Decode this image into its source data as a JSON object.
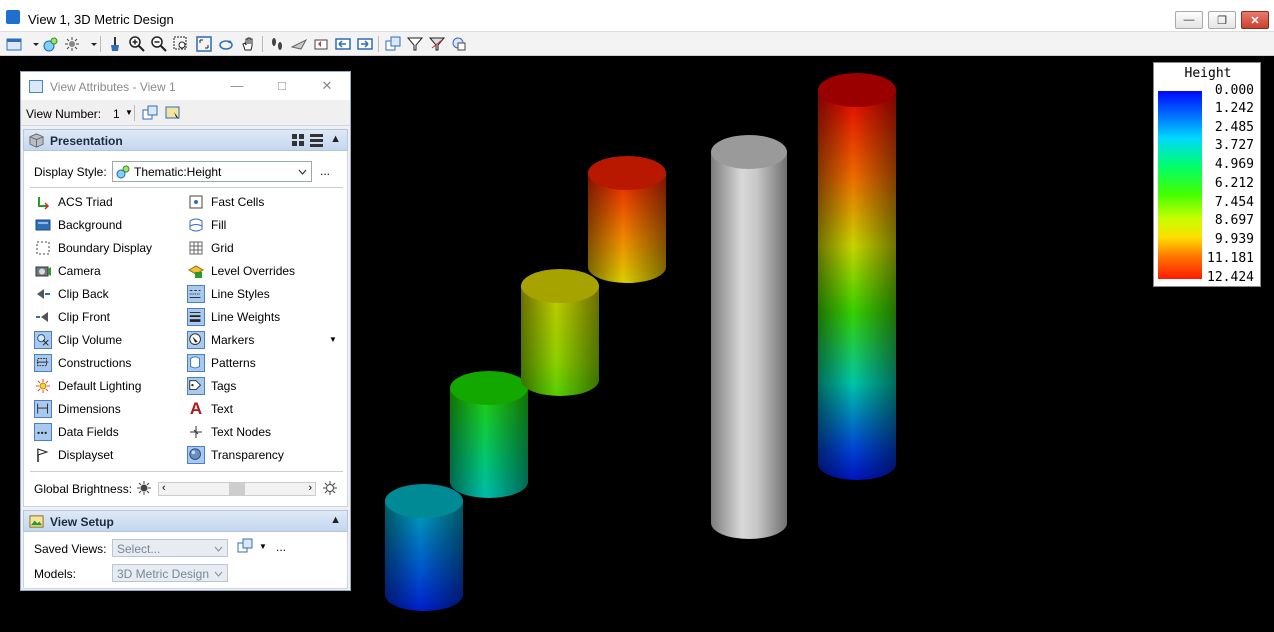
{
  "window": {
    "title": "View 1, 3D Metric Design"
  },
  "dialog": {
    "title": "View Attributes - View 1",
    "view_number_label": "View Number:",
    "view_number_value": "1",
    "presentation": {
      "header": "Presentation",
      "display_style_label": "Display Style:",
      "display_style_value": "Thematic:Height",
      "more": "...",
      "left_items": [
        {
          "label": "ACS Triad",
          "icon": "acs-triad-icon",
          "on": false
        },
        {
          "label": "Background",
          "icon": "background-icon",
          "on": false
        },
        {
          "label": "Boundary Display",
          "icon": "boundary-display-icon",
          "on": false
        },
        {
          "label": "Camera",
          "icon": "camera-icon",
          "on": false
        },
        {
          "label": "Clip Back",
          "icon": "clip-back-icon",
          "on": false
        },
        {
          "label": "Clip Front",
          "icon": "clip-front-icon",
          "on": false
        },
        {
          "label": "Clip Volume",
          "icon": "clip-volume-icon",
          "on": true
        },
        {
          "label": "Constructions",
          "icon": "constructions-icon",
          "on": true
        },
        {
          "label": "Default Lighting",
          "icon": "default-lighting-icon",
          "on": false
        },
        {
          "label": "Dimensions",
          "icon": "dimensions-icon",
          "on": true
        },
        {
          "label": "Data Fields",
          "icon": "data-fields-icon",
          "on": true
        },
        {
          "label": "Displayset",
          "icon": "displayset-icon",
          "on": false
        }
      ],
      "right_items": [
        {
          "label": "Fast Cells",
          "icon": "fast-cells-icon",
          "on": false
        },
        {
          "label": "Fill",
          "icon": "fill-icon",
          "on": false
        },
        {
          "label": "Grid",
          "icon": "grid-icon",
          "on": false
        },
        {
          "label": "Level Overrides",
          "icon": "level-overrides-icon",
          "on": false
        },
        {
          "label": "Line Styles",
          "icon": "line-styles-icon",
          "on": true
        },
        {
          "label": "Line Weights",
          "icon": "line-weights-icon",
          "on": true
        },
        {
          "label": "Markers",
          "icon": "markers-icon",
          "on": true
        },
        {
          "label": "Patterns",
          "icon": "patterns-icon",
          "on": true
        },
        {
          "label": "Tags",
          "icon": "tags-icon",
          "on": true
        },
        {
          "label": "Text",
          "icon": "text-icon",
          "on": false
        },
        {
          "label": "Text Nodes",
          "icon": "text-nodes-icon",
          "on": false
        },
        {
          "label": "Transparency",
          "icon": "transparency-icon",
          "on": true
        }
      ],
      "global_brightness_label": "Global Brightness:",
      "global_brightness_level": 0.5
    },
    "view_setup": {
      "header": "View Setup",
      "saved_views_label": "Saved Views:",
      "saved_views_placeholder": "Select...",
      "more": "...",
      "models_label": "Models:",
      "models_value": "3D Metric Design"
    }
  },
  "legend": {
    "title": "Height",
    "values": [
      "0.000",
      "1.242",
      "2.485",
      "3.727",
      "4.969",
      "6.212",
      "7.454",
      "8.697",
      "9.939",
      "11.181",
      "12.424"
    ]
  },
  "colors": {
    "viewport_bg": "#000000",
    "accent": "#4a7fc1",
    "section_header": "#c4d7f0"
  }
}
